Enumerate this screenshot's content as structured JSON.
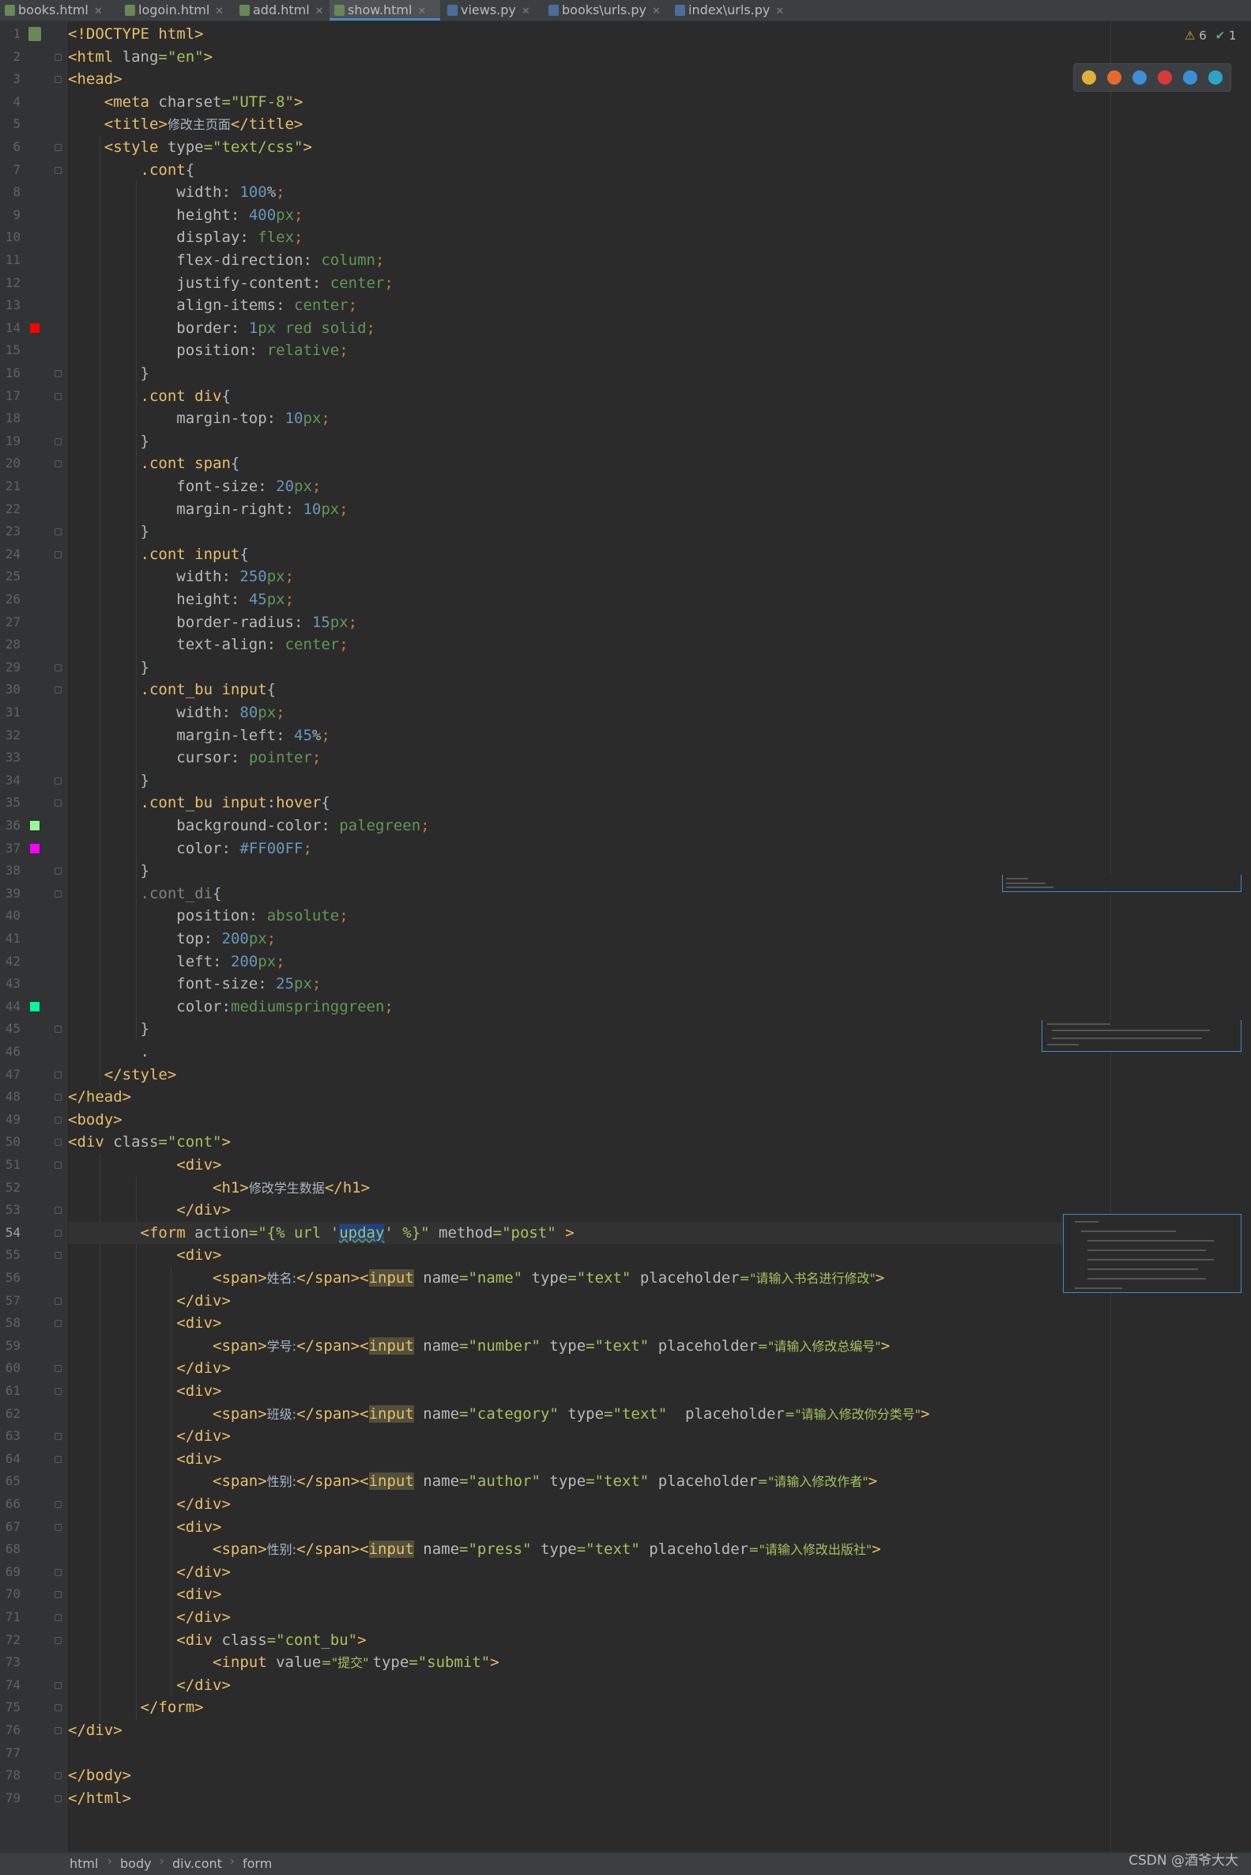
{
  "tabs": [
    {
      "label": "books.html",
      "icon": "html-file-icon"
    },
    {
      "label": "logoin.html",
      "icon": "html-file-icon"
    },
    {
      "label": "add.html",
      "icon": "html-file-icon"
    },
    {
      "label": "show.html",
      "icon": "html-file-icon",
      "active": true
    },
    {
      "label": "views.py",
      "icon": "python-file-icon"
    },
    {
      "label": "books\\urls.py",
      "icon": "python-file-icon"
    },
    {
      "label": "index\\urls.py",
      "icon": "python-file-icon"
    }
  ],
  "inspections": {
    "warnings": "6",
    "ok": "1"
  },
  "browsers": [
    "chrome-icon",
    "firefox-icon",
    "safari-icon",
    "opera-icon",
    "ie-icon",
    "edge-icon"
  ],
  "current_line": 54,
  "color_swatches": {
    "14": "#ff0000",
    "36": "#98fb98",
    "37": "#ff00ff",
    "44": "#00fa9a"
  },
  "lines": [
    [
      [
        "t",
        "<!DOCTYPE html>"
      ]
    ],
    [
      [
        "t",
        "<html "
      ],
      [
        "a",
        "lang"
      ],
      [
        "s",
        "=\"en\""
      ],
      [
        "t",
        ">"
      ]
    ],
    [
      [
        "t",
        "<head>"
      ]
    ],
    [
      [
        "p",
        "    "
      ],
      [
        "t",
        "<meta "
      ],
      [
        "a",
        "charset"
      ],
      [
        "s",
        "=\"UTF-8\""
      ],
      [
        "t",
        ">"
      ]
    ],
    [
      [
        "p",
        "    "
      ],
      [
        "t",
        "<title>"
      ],
      [
        "p",
        "修改主页面"
      ],
      [
        "t",
        "</title>"
      ]
    ],
    [
      [
        "p",
        "    "
      ],
      [
        "t",
        "<style "
      ],
      [
        "a",
        "type"
      ],
      [
        "s",
        "=\"text/css\""
      ],
      [
        "t",
        ">"
      ]
    ],
    [
      [
        "p",
        "        "
      ],
      [
        "c",
        ".cont"
      ],
      [
        "p",
        "{"
      ]
    ],
    [
      [
        "p",
        "            "
      ],
      [
        "a",
        "width"
      ],
      [
        "p",
        ": "
      ],
      [
        "n",
        "100"
      ],
      [
        "p",
        "%"
      ],
      [
        "k",
        ";"
      ]
    ],
    [
      [
        "p",
        "            "
      ],
      [
        "a",
        "height"
      ],
      [
        "p",
        ": "
      ],
      [
        "n",
        "400"
      ],
      [
        "d",
        "px"
      ],
      [
        "k",
        ";"
      ]
    ],
    [
      [
        "p",
        "            "
      ],
      [
        "a",
        "display"
      ],
      [
        "p",
        ": "
      ],
      [
        "d",
        "flex"
      ],
      [
        "k",
        ";"
      ]
    ],
    [
      [
        "p",
        "            "
      ],
      [
        "a",
        "flex-direction"
      ],
      [
        "p",
        ": "
      ],
      [
        "d",
        "column"
      ],
      [
        "k",
        ";"
      ]
    ],
    [
      [
        "p",
        "            "
      ],
      [
        "a",
        "justify-content"
      ],
      [
        "p",
        ": "
      ],
      [
        "d",
        "center"
      ],
      [
        "k",
        ";"
      ]
    ],
    [
      [
        "p",
        "            "
      ],
      [
        "a",
        "align-items"
      ],
      [
        "p",
        ": "
      ],
      [
        "d",
        "center"
      ],
      [
        "k",
        ";"
      ]
    ],
    [
      [
        "p",
        "            "
      ],
      [
        "a",
        "border"
      ],
      [
        "p",
        ": "
      ],
      [
        "n",
        "1"
      ],
      [
        "d",
        "px red solid"
      ],
      [
        "k",
        ";"
      ]
    ],
    [
      [
        "p",
        "            "
      ],
      [
        "a",
        "position"
      ],
      [
        "p",
        ": "
      ],
      [
        "d",
        "relative"
      ],
      [
        "k",
        ";"
      ]
    ],
    [
      [
        "p",
        "        }"
      ]
    ],
    [
      [
        "p",
        "        "
      ],
      [
        "c",
        ".cont div"
      ],
      [
        "p",
        "{"
      ]
    ],
    [
      [
        "p",
        "            "
      ],
      [
        "a",
        "margin-top"
      ],
      [
        "p",
        ": "
      ],
      [
        "n",
        "10"
      ],
      [
        "d",
        "px"
      ],
      [
        "k",
        ";"
      ]
    ],
    [
      [
        "p",
        "        }"
      ]
    ],
    [
      [
        "p",
        "        "
      ],
      [
        "c",
        ".cont span"
      ],
      [
        "p",
        "{"
      ]
    ],
    [
      [
        "p",
        "            "
      ],
      [
        "a",
        "font-size"
      ],
      [
        "p",
        ": "
      ],
      [
        "n",
        "20"
      ],
      [
        "d",
        "px"
      ],
      [
        "k",
        ";"
      ]
    ],
    [
      [
        "p",
        "            "
      ],
      [
        "a",
        "margin-right"
      ],
      [
        "p",
        ": "
      ],
      [
        "n",
        "10"
      ],
      [
        "d",
        "px"
      ],
      [
        "k",
        ";"
      ]
    ],
    [
      [
        "p",
        "        }"
      ]
    ],
    [
      [
        "p",
        "        "
      ],
      [
        "c",
        ".cont input"
      ],
      [
        "p",
        "{"
      ]
    ],
    [
      [
        "p",
        "            "
      ],
      [
        "a",
        "width"
      ],
      [
        "p",
        ": "
      ],
      [
        "n",
        "250"
      ],
      [
        "d",
        "px"
      ],
      [
        "k",
        ";"
      ]
    ],
    [
      [
        "p",
        "            "
      ],
      [
        "a",
        "height"
      ],
      [
        "p",
        ": "
      ],
      [
        "n",
        "45"
      ],
      [
        "d",
        "px"
      ],
      [
        "k",
        ";"
      ]
    ],
    [
      [
        "p",
        "            "
      ],
      [
        "a",
        "border-radius"
      ],
      [
        "p",
        ": "
      ],
      [
        "n",
        "15"
      ],
      [
        "d",
        "px"
      ],
      [
        "k",
        ";"
      ]
    ],
    [
      [
        "p",
        "            "
      ],
      [
        "a",
        "text-align"
      ],
      [
        "p",
        ": "
      ],
      [
        "d",
        "center"
      ],
      [
        "k",
        ";"
      ]
    ],
    [
      [
        "p",
        "        }"
      ]
    ],
    [
      [
        "p",
        "        "
      ],
      [
        "c",
        ".cont_bu input"
      ],
      [
        "p",
        "{"
      ]
    ],
    [
      [
        "p",
        "            "
      ],
      [
        "a",
        "width"
      ],
      [
        "p",
        ": "
      ],
      [
        "n",
        "80"
      ],
      [
        "d",
        "px"
      ],
      [
        "k",
        ";"
      ]
    ],
    [
      [
        "p",
        "            "
      ],
      [
        "a",
        "margin-left"
      ],
      [
        "p",
        ": "
      ],
      [
        "n",
        "45"
      ],
      [
        "p",
        "%"
      ],
      [
        "k",
        ";"
      ]
    ],
    [
      [
        "p",
        "            "
      ],
      [
        "a",
        "cursor"
      ],
      [
        "p",
        ": "
      ],
      [
        "d",
        "pointer"
      ],
      [
        "k",
        ";"
      ]
    ],
    [
      [
        "p",
        "        }"
      ]
    ],
    [
      [
        "p",
        "        "
      ],
      [
        "c",
        ".cont_bu input"
      ],
      [
        "p",
        ":"
      ],
      [
        "c",
        "hover"
      ],
      [
        "p",
        "{"
      ]
    ],
    [
      [
        "p",
        "            "
      ],
      [
        "a",
        "background-color"
      ],
      [
        "p",
        ": "
      ],
      [
        "d",
        "palegreen"
      ],
      [
        "k",
        ";"
      ]
    ],
    [
      [
        "p",
        "            "
      ],
      [
        "a",
        "color"
      ],
      [
        "p",
        ": "
      ],
      [
        "n",
        "#FF00FF"
      ],
      [
        "k",
        ";"
      ]
    ],
    [
      [
        "p",
        "        }"
      ]
    ],
    [
      [
        "p",
        "        "
      ],
      [
        "m",
        ".cont_di"
      ],
      [
        "p",
        "{"
      ]
    ],
    [
      [
        "p",
        "            "
      ],
      [
        "a",
        "position"
      ],
      [
        "p",
        ": "
      ],
      [
        "d",
        "absolute"
      ],
      [
        "k",
        ";"
      ]
    ],
    [
      [
        "p",
        "            "
      ],
      [
        "a",
        "top"
      ],
      [
        "p",
        ": "
      ],
      [
        "n",
        "200"
      ],
      [
        "d",
        "px"
      ],
      [
        "k",
        ";"
      ]
    ],
    [
      [
        "p",
        "            "
      ],
      [
        "a",
        "left"
      ],
      [
        "p",
        ": "
      ],
      [
        "n",
        "200"
      ],
      [
        "d",
        "px"
      ],
      [
        "k",
        ";"
      ]
    ],
    [
      [
        "p",
        "            "
      ],
      [
        "a",
        "font-size"
      ],
      [
        "p",
        ": "
      ],
      [
        "n",
        "25"
      ],
      [
        "d",
        "px"
      ],
      [
        "k",
        ";"
      ]
    ],
    [
      [
        "p",
        "            "
      ],
      [
        "a",
        "color"
      ],
      [
        "p",
        ":"
      ],
      [
        "d",
        "mediumspringgreen"
      ],
      [
        "k",
        ";"
      ]
    ],
    [
      [
        "p",
        "        }"
      ]
    ],
    [
      [
        "p",
        "        ."
      ]
    ],
    [
      [
        "p",
        "    "
      ],
      [
        "t",
        "</style>"
      ]
    ],
    [
      [
        "t",
        "</head>"
      ]
    ],
    [
      [
        "t",
        "<body>"
      ]
    ],
    [
      [
        "t",
        "<div "
      ],
      [
        "a",
        "class"
      ],
      [
        "s",
        "=\"cont\""
      ],
      [
        "t",
        ">"
      ]
    ],
    [
      [
        "p",
        "            "
      ],
      [
        "t",
        "<div>"
      ]
    ],
    [
      [
        "p",
        "                "
      ],
      [
        "t",
        "<h1>"
      ],
      [
        "p",
        "修改学生数据"
      ],
      [
        "t",
        "</h1>"
      ]
    ],
    [
      [
        "p",
        "            "
      ],
      [
        "t",
        "</div>"
      ]
    ],
    [
      [
        "p",
        "        "
      ],
      [
        "t",
        "<form "
      ],
      [
        "a",
        "action"
      ],
      [
        "s",
        "=\"{% url '"
      ],
      [
        "sel",
        "upday"
      ],
      [
        "s",
        "' %}\" "
      ],
      [
        "a",
        "method"
      ],
      [
        "s",
        "=\"post\" "
      ],
      [
        "t",
        ">"
      ]
    ],
    [
      [
        "p",
        "            "
      ],
      [
        "t",
        "<div>"
      ]
    ],
    [
      [
        "p",
        "                "
      ],
      [
        "t",
        "<span>"
      ],
      [
        "p",
        "姓名:"
      ],
      [
        "t",
        "</span><"
      ],
      [
        "hl",
        "input"
      ],
      [
        "p",
        " "
      ],
      [
        "a",
        "name"
      ],
      [
        "s",
        "=\"name\" "
      ],
      [
        "a",
        "type"
      ],
      [
        "s",
        "=\"text\" "
      ],
      [
        "a",
        "placeholder"
      ],
      [
        "s",
        "=\"请输入书名进行修改\""
      ],
      [
        "t",
        ">"
      ]
    ],
    [
      [
        "p",
        "            "
      ],
      [
        "t",
        "</div>"
      ]
    ],
    [
      [
        "p",
        "            "
      ],
      [
        "t",
        "<div>"
      ]
    ],
    [
      [
        "p",
        "                "
      ],
      [
        "t",
        "<span>"
      ],
      [
        "p",
        "学号:"
      ],
      [
        "t",
        "</span><"
      ],
      [
        "hl",
        "input"
      ],
      [
        "p",
        " "
      ],
      [
        "a",
        "name"
      ],
      [
        "s",
        "=\"number\" "
      ],
      [
        "a",
        "type"
      ],
      [
        "s",
        "=\"text\" "
      ],
      [
        "a",
        "placeholder"
      ],
      [
        "s",
        "=\"请输入修改总编号\""
      ],
      [
        "t",
        ">"
      ]
    ],
    [
      [
        "p",
        "            "
      ],
      [
        "t",
        "</div>"
      ]
    ],
    [
      [
        "p",
        "            "
      ],
      [
        "t",
        "<div>"
      ]
    ],
    [
      [
        "p",
        "                "
      ],
      [
        "t",
        "<span>"
      ],
      [
        "p",
        "班级:"
      ],
      [
        "t",
        "</span><"
      ],
      [
        "hl",
        "input"
      ],
      [
        "p",
        " "
      ],
      [
        "a",
        "name"
      ],
      [
        "s",
        "=\"category\" "
      ],
      [
        "a",
        "type"
      ],
      [
        "s",
        "=\"text\"  "
      ],
      [
        "a",
        "placeholder"
      ],
      [
        "s",
        "=\"请输入修改你分类号\""
      ],
      [
        "t",
        ">"
      ]
    ],
    [
      [
        "p",
        "            "
      ],
      [
        "t",
        "</div>"
      ]
    ],
    [
      [
        "p",
        "            "
      ],
      [
        "t",
        "<div>"
      ]
    ],
    [
      [
        "p",
        "                "
      ],
      [
        "t",
        "<span>"
      ],
      [
        "p",
        "性别:"
      ],
      [
        "t",
        "</span><"
      ],
      [
        "hl",
        "input"
      ],
      [
        "p",
        " "
      ],
      [
        "a",
        "name"
      ],
      [
        "s",
        "=\"author\" "
      ],
      [
        "a",
        "type"
      ],
      [
        "s",
        "=\"text\" "
      ],
      [
        "a",
        "placeholder"
      ],
      [
        "s",
        "=\"请输入修改作者\""
      ],
      [
        "t",
        ">"
      ]
    ],
    [
      [
        "p",
        "            "
      ],
      [
        "t",
        "</div>"
      ]
    ],
    [
      [
        "p",
        "            "
      ],
      [
        "t",
        "<div>"
      ]
    ],
    [
      [
        "p",
        "                "
      ],
      [
        "t",
        "<span>"
      ],
      [
        "p",
        "性别:"
      ],
      [
        "t",
        "</span><"
      ],
      [
        "hl",
        "input"
      ],
      [
        "p",
        " "
      ],
      [
        "a",
        "name"
      ],
      [
        "s",
        "=\"press\" "
      ],
      [
        "a",
        "type"
      ],
      [
        "s",
        "=\"text\" "
      ],
      [
        "a",
        "placeholder"
      ],
      [
        "s",
        "=\"请输入修改出版社\""
      ],
      [
        "t",
        ">"
      ]
    ],
    [
      [
        "p",
        "            "
      ],
      [
        "t",
        "</div>"
      ]
    ],
    [
      [
        "p",
        "            "
      ],
      [
        "t",
        "<div>"
      ]
    ],
    [
      [
        "p",
        "            "
      ],
      [
        "t",
        "</div>"
      ]
    ],
    [
      [
        "p",
        "            "
      ],
      [
        "t",
        "<div "
      ],
      [
        "a",
        "class"
      ],
      [
        "s",
        "=\"cont_bu\""
      ],
      [
        "t",
        ">"
      ]
    ],
    [
      [
        "p",
        "                "
      ],
      [
        "t",
        "<input "
      ],
      [
        "a",
        "value"
      ],
      [
        "s",
        "=\"提交\" "
      ],
      [
        "a",
        "type"
      ],
      [
        "s",
        "=\"submit\""
      ],
      [
        "t",
        ">"
      ]
    ],
    [
      [
        "p",
        "            "
      ],
      [
        "t",
        "</div>"
      ]
    ],
    [
      [
        "p",
        "        "
      ],
      [
        "t",
        "</form>"
      ]
    ],
    [
      [
        "t",
        "</div>"
      ]
    ],
    [],
    [
      [
        "t",
        "</body>"
      ]
    ],
    [
      [
        "t",
        "</html>"
      ]
    ]
  ],
  "breadcrumbs": [
    "html",
    "body",
    "div.cont",
    "form"
  ],
  "watermark": "CSDN @酒爷大大"
}
